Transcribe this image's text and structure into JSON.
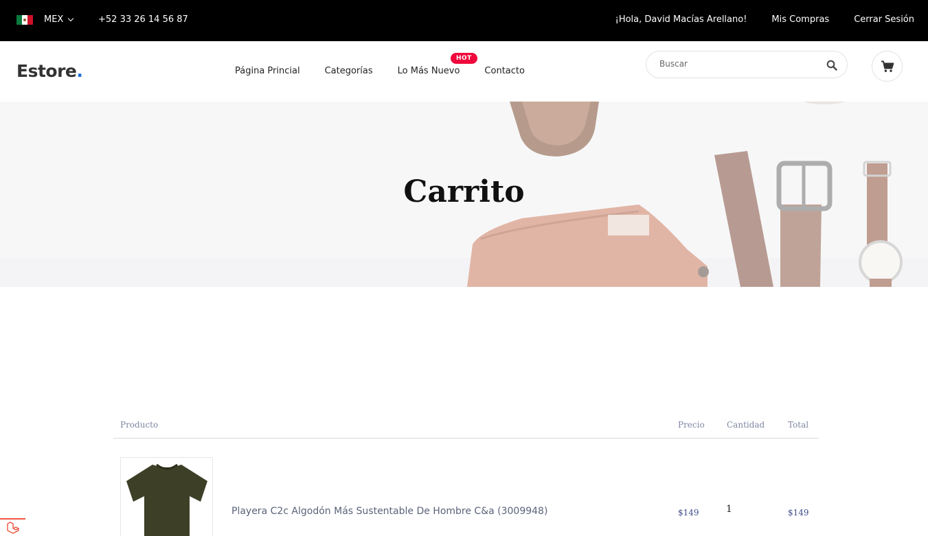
{
  "topbar": {
    "country": "MEX",
    "phone": "+52 33 26 14 56 87",
    "greeting": "¡Hola, David Macías Arellano!",
    "my_purchases": "Mis Compras",
    "logout": "Cerrar Sesión"
  },
  "header": {
    "logo_text": "Estore",
    "logo_dot": ".",
    "nav": [
      "Página Princial",
      "Categorías",
      "Lo Más Nuevo",
      "Contacto"
    ],
    "hot_badge": "HOT",
    "search_placeholder": "Buscar"
  },
  "hero": {
    "title": "Carrito"
  },
  "cart": {
    "headers": {
      "product": "Producto",
      "price": "Precio",
      "quantity": "Cantidad",
      "total": "Total"
    },
    "items": [
      {
        "name": "Playera C2c Algodón Más Sustentable De Hombre C&a (3009948)",
        "price": "$149",
        "quantity": "1",
        "total": "$149"
      }
    ]
  },
  "colors": {
    "accent": "#1a6bd6",
    "hot": "#f0083c",
    "price": "#3b4a8a"
  }
}
